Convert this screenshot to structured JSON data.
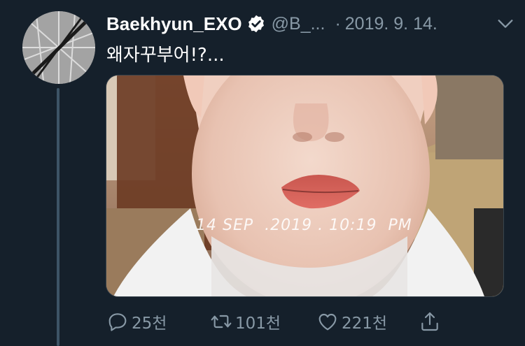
{
  "tweet": {
    "display_name": "Baekhyun_EXO",
    "handle": "@B_...",
    "separator": "·",
    "date": "2019. 9. 14.",
    "text": "왜자꾸부어!?...",
    "media": {
      "timestamp_overlay": "14 SEP  .2019 . 10:19  PM"
    }
  },
  "actions": {
    "reply_count": "25천",
    "retweet_count": "101천",
    "like_count": "221천"
  },
  "icons": {
    "verified": "verified-badge-icon",
    "caret": "chevron-down-icon",
    "reply": "reply-icon",
    "retweet": "retweet-icon",
    "like": "heart-icon",
    "share": "share-icon"
  },
  "colors": {
    "background": "#15202b",
    "secondary_text": "#8899a6",
    "thread_line": "#3d5466"
  }
}
